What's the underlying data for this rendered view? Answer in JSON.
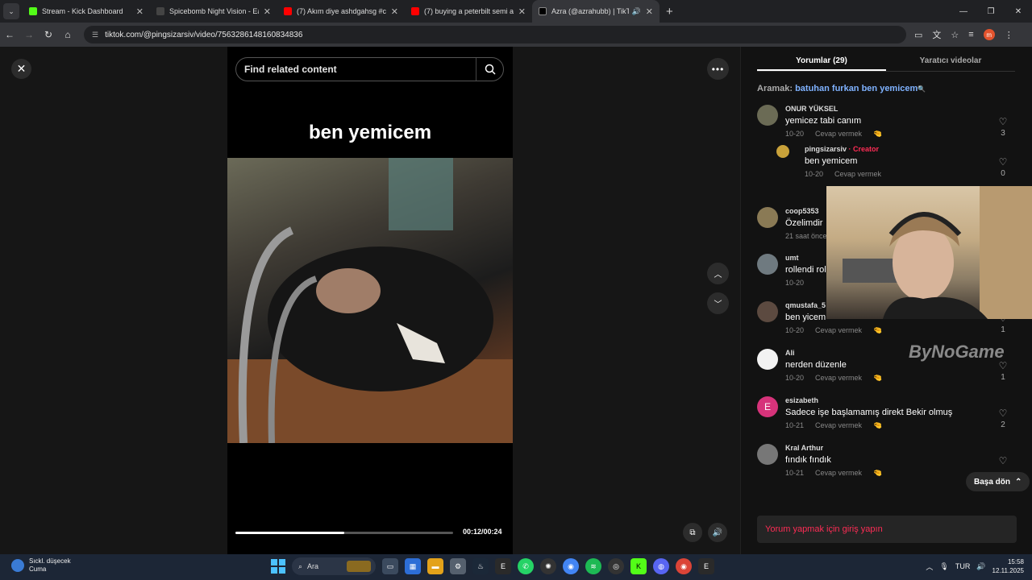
{
  "tabs": [
    {
      "title": "Stream - Kick Dashboard",
      "color": "#53fc18",
      "active": false
    },
    {
      "title": "Spicebomb Night Vision - Eau d",
      "color": "#222222",
      "active": false
    },
    {
      "title": "(7) Akım diye ashdgahsg #cs2 #",
      "color": "#ff0000",
      "active": false
    },
    {
      "title": "(7) buying a peterbilt semi and",
      "color": "#ff0000",
      "active": false
    },
    {
      "title": "Azra (@azrahubb) | TikTok",
      "color": "#000000",
      "active": true
    }
  ],
  "url": "tiktok.com/@pingsizarsiv/video/7563286148160834836",
  "player": {
    "search_placeholder": "Find related content",
    "caption": "ben yemicem",
    "time": "00:12/00:24",
    "progress": 0.5
  },
  "panel": {
    "tab_comments": "Yorumlar (29)",
    "tab_creator": "Yaratıcı videolar",
    "aramak_label": "Aramak: ",
    "aramak_query": "batuhan furkan ben yemicem",
    "comments": [
      {
        "name": "ONUR YÜKSEL",
        "text": "yemicez tabi canım",
        "date": "10-20",
        "reply": "Cevap vermek",
        "likes": "3"
      },
      {
        "name": "pingsizarsiv",
        "creator_tag": " · Creator",
        "text": "ben yemicem",
        "date": "10-20",
        "reply": "Cevap vermek",
        "likes": "0"
      },
      {
        "name": "coop5353",
        "text": "Özelimdir",
        "date": "21 saat önce",
        "reply": "",
        "likes": ""
      },
      {
        "name": "umt",
        "text": "rollendi rol",
        "date": "10-20",
        "reply": "",
        "likes": ""
      },
      {
        "name": "qmustafa_5",
        "text": "ben yicem",
        "date": "10-20",
        "reply": "Cevap vermek",
        "likes": "1"
      },
      {
        "name": "Ali",
        "text": "nerden düzenle",
        "date": "10-20",
        "reply": "Cevap vermek",
        "likes": "1"
      },
      {
        "name": "esizabeth",
        "initial": "E",
        "text": "Sadece işe başlamamış direkt Bekir olmuş",
        "date": "10-21",
        "reply": "Cevap vermek",
        "likes": "2"
      },
      {
        "name": "Kral Arthur",
        "text": "fındık fındık",
        "date": "10-21",
        "reply": "Cevap vermek",
        "likes": ""
      }
    ],
    "back_top": "Başa dön",
    "login": "Yorum yapmak için giriş yapın",
    "watermark": "ByNoGame"
  },
  "taskbar": {
    "weather_line1": "Sıckl. düşecek",
    "weather_line2": "Cuma",
    "search": "Ara",
    "lang": "TUR",
    "time": "15:58",
    "date": "12.11.2025"
  }
}
